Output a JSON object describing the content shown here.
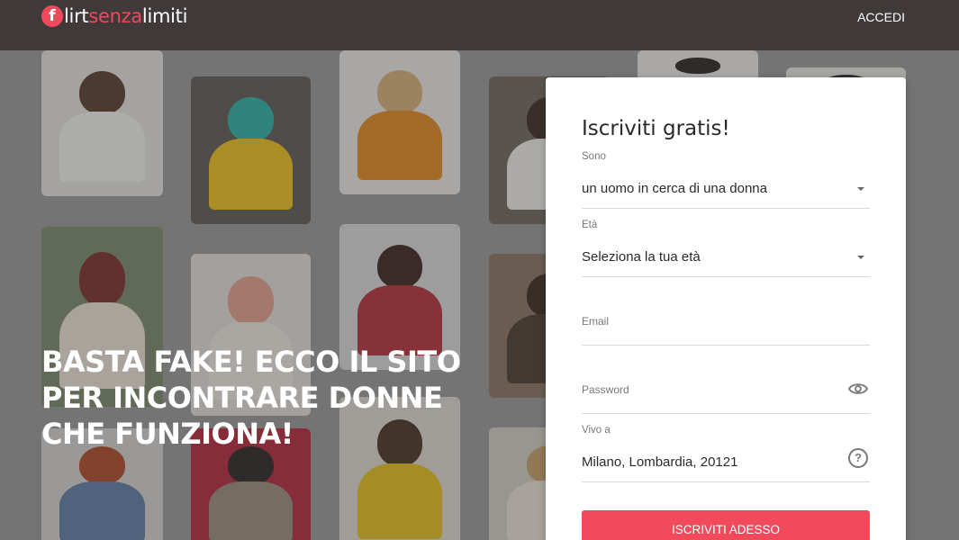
{
  "header": {
    "logo_letter": "f",
    "logo_part1": "lirt",
    "logo_part2": "senza",
    "logo_part3": "limiti",
    "login_label": "ACCEDI"
  },
  "hero": {
    "headline": "BASTA FAKE! ECCO IL SITO PER INCONTRARE DONNE CHE FUNZIONA!"
  },
  "form": {
    "title": "Iscriviti gratis!",
    "gender_label": "Sono",
    "gender_value": "un uomo in cerca di una donna",
    "age_label": "Età",
    "age_value": "Seleziona la tua età",
    "email_placeholder": "Email",
    "password_placeholder": "Password",
    "location_label": "Vivo a",
    "location_value": "Milano, Lombardia, 20121",
    "submit_label": "ISCRIVITI ADESSO"
  },
  "colors": {
    "accent": "#f04a5c",
    "header_bg": "#3f3a39"
  }
}
